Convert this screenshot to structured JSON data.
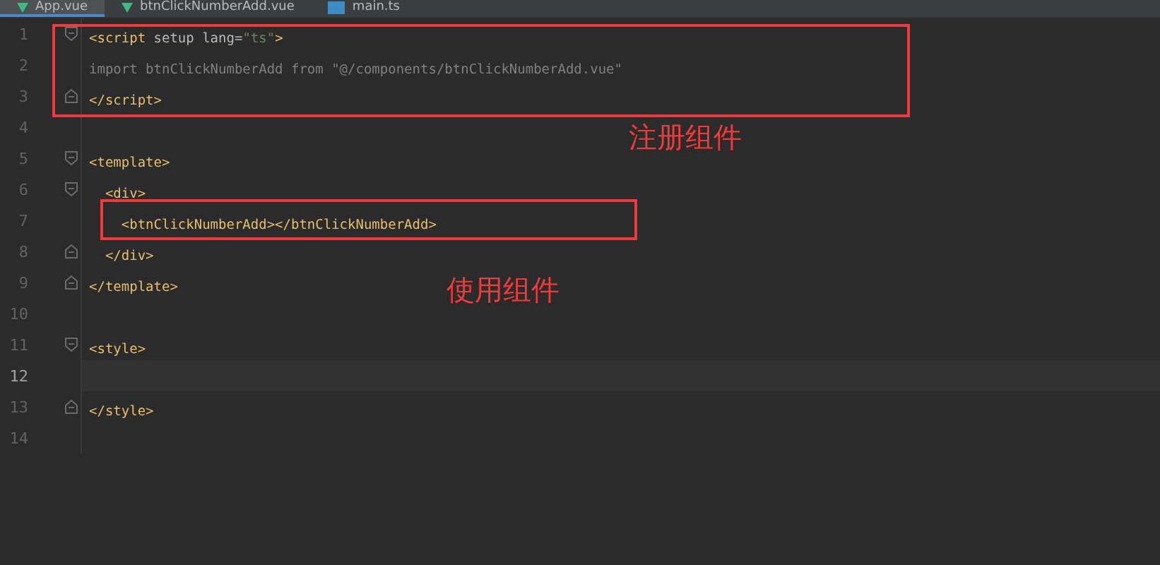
{
  "tabs": [
    {
      "label": "App.vue",
      "kind": "vue",
      "selected": true
    },
    {
      "label": "btnClickNumberAdd.vue",
      "kind": "vue",
      "selected": false
    },
    {
      "label": "main.ts",
      "kind": "ts",
      "selected": false
    }
  ],
  "lines": [
    {
      "number": "1",
      "kind": "fold-start",
      "current": false,
      "tokens": [
        {
          "text": "<script",
          "kind": "tag"
        },
        {
          "text": " setup lang=",
          "kind": "attr"
        },
        {
          "text": "\"ts\"",
          "kind": "string"
        },
        {
          "text": ">",
          "kind": "tag"
        }
      ]
    },
    {
      "number": "2",
      "kind": "plain",
      "current": false,
      "tokens": [
        {
          "text": "import btnClickNumberAdd from \"@/components/btnClickNumberAdd.vue\"",
          "kind": "unused"
        }
      ]
    },
    {
      "number": "3",
      "kind": "fold-end",
      "current": false,
      "tokens": [
        {
          "text": "</script>",
          "kind": "tag"
        }
      ]
    },
    {
      "number": "4",
      "kind": "plain",
      "current": false
    },
    {
      "number": "5",
      "kind": "fold-start",
      "current": false,
      "tokens": [
        {
          "text": "<template>",
          "kind": "tag"
        }
      ]
    },
    {
      "number": "6",
      "kind": "fold-start",
      "current": false,
      "tokens": [
        {
          "text": "  <div>",
          "kind": "tag"
        }
      ]
    },
    {
      "number": "7",
      "kind": "plain",
      "current": false,
      "tokens": [
        {
          "text": "    <btnClickNumberAdd></btnClickNumberAdd>",
          "kind": "tag"
        }
      ]
    },
    {
      "number": "8",
      "kind": "fold-end",
      "current": false,
      "tokens": [
        {
          "text": "  </div>",
          "kind": "tag"
        }
      ]
    },
    {
      "number": "9",
      "kind": "fold-end",
      "current": false,
      "tokens": [
        {
          "text": "</template>",
          "kind": "tag"
        }
      ]
    },
    {
      "number": "10",
      "kind": "plain",
      "current": false
    },
    {
      "number": "11",
      "kind": "fold-start",
      "current": false,
      "tokens": [
        {
          "text": "<style>",
          "kind": "tag"
        }
      ]
    },
    {
      "number": "12",
      "kind": "plain",
      "current": true
    },
    {
      "number": "13",
      "kind": "fold-end",
      "current": false,
      "tokens": [
        {
          "text": "</style>",
          "kind": "tag"
        }
      ]
    },
    {
      "number": "14",
      "kind": "plain",
      "current": false
    }
  ],
  "annotations": [
    {
      "label": "注册组件"
    },
    {
      "label": "使用组件"
    }
  ]
}
